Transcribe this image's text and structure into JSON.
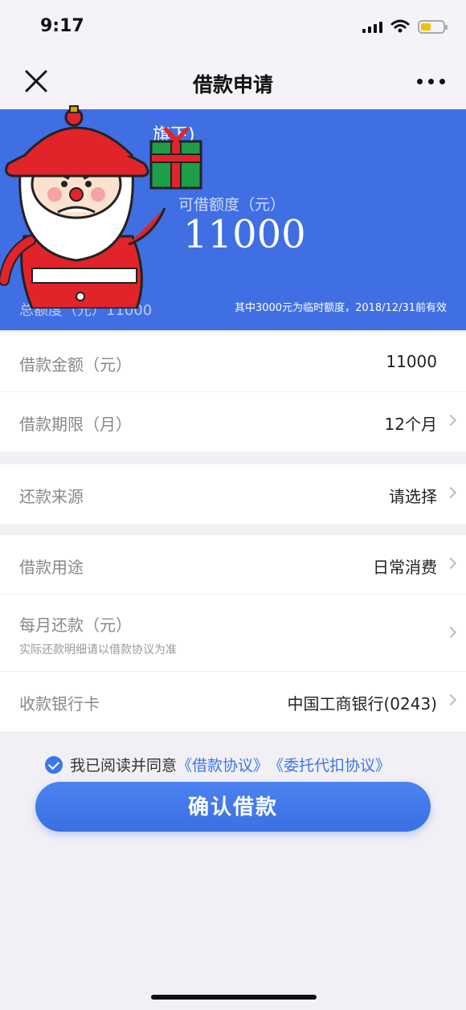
{
  "status": {
    "time": "9:17"
  },
  "nav": {
    "title": "借款申请"
  },
  "banner": {
    "partial_text": "旗下)",
    "available_label": "可借额度（元）",
    "available_amount": "11000",
    "total_label": "总额度（元）11000",
    "note": "其中3000元为临时额度，2018/12/31前有效"
  },
  "form": {
    "amount_label": "借款金额（元）",
    "amount_value": "11000",
    "term_label": "借款期限（月）",
    "term_value": "12个月",
    "source_label": "还款来源",
    "source_value": "请选择",
    "purpose_label": "借款用途",
    "purpose_value": "日常消费",
    "monthly_label": "每月还款（元）",
    "monthly_sub": "实际还款明细请以借款协议为准",
    "bank_label": "收款银行卡",
    "bank_value": "中国工商银行(0243)"
  },
  "agreement": {
    "prefix": "我已阅读并同意",
    "link1": "《借款协议》",
    "link2": "《委托代扣协议》"
  },
  "confirm_label": "确认借款"
}
